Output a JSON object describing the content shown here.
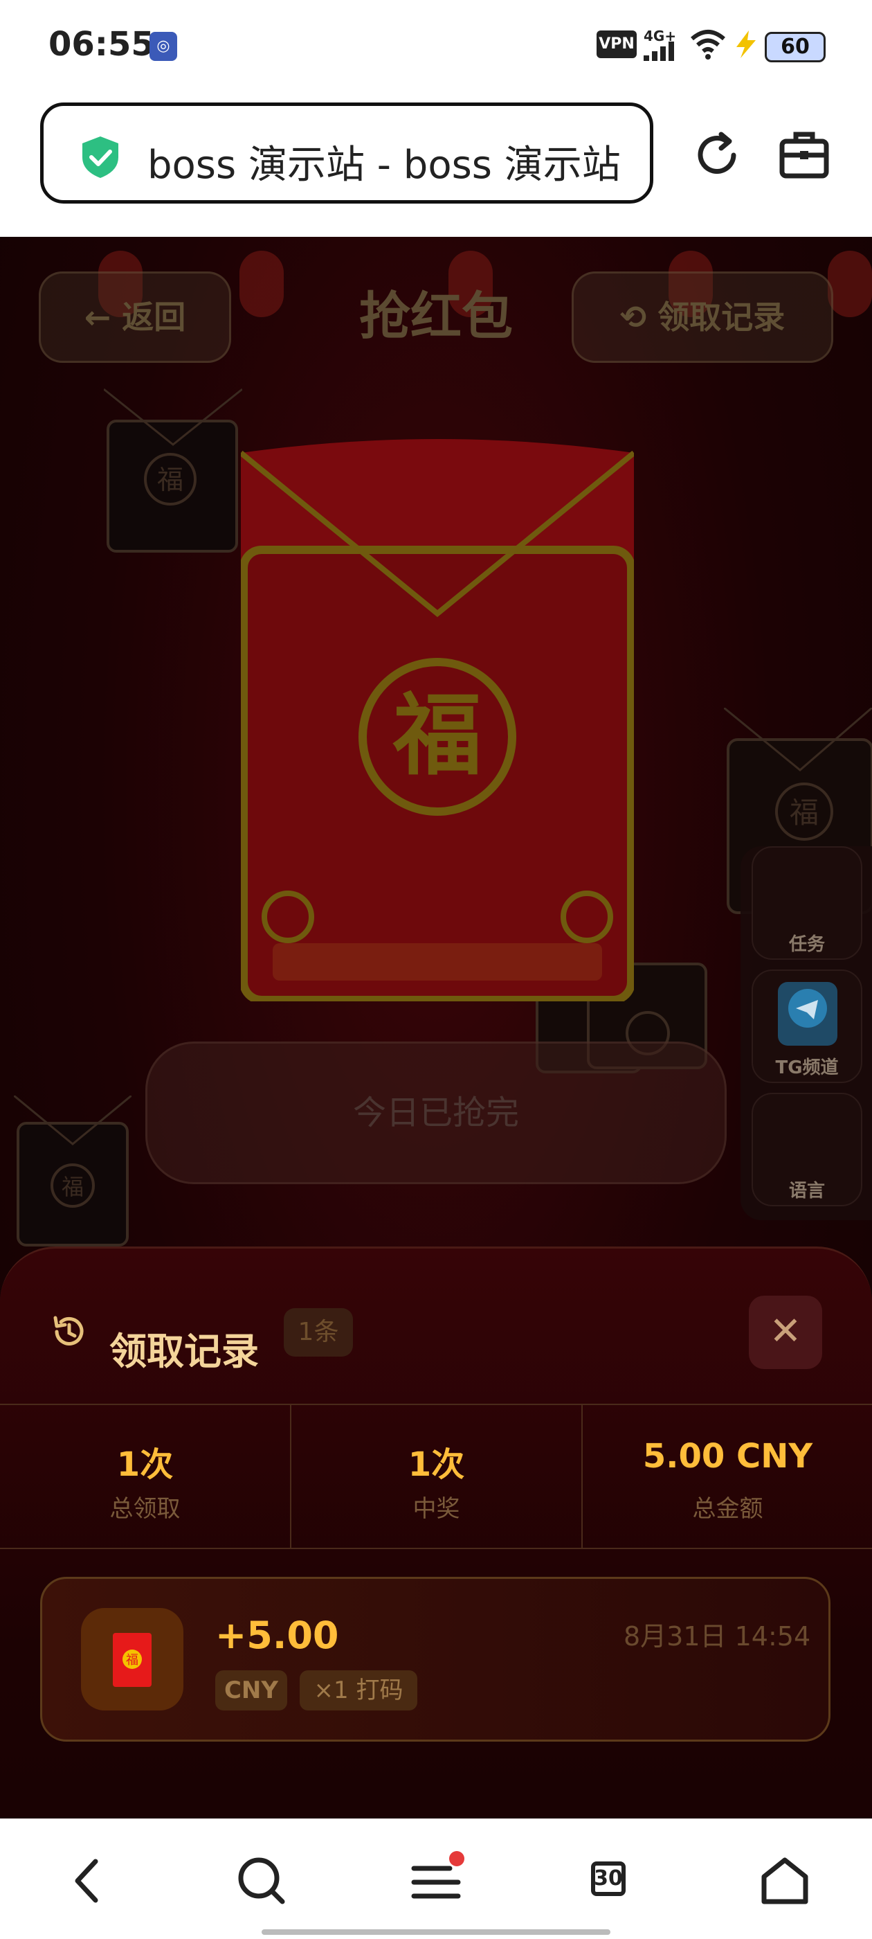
{
  "status_bar": {
    "time": "06:55",
    "notification_icon": "app-notification-icon",
    "vpn_label": "VPN",
    "network_label": "4G+",
    "battery": "60"
  },
  "browser": {
    "address_text": "boss 演示站 - boss 演示站",
    "secure_icon": "shield-check-icon",
    "reload_icon": "reload-icon",
    "toolbox_icon": "toolbox-icon"
  },
  "page": {
    "back_label": "返回",
    "title": "抢红包",
    "history_label": "领取记录",
    "envelope_char": "福",
    "grab_button_label": "今日已抢完",
    "side_menu": [
      {
        "label": "任务",
        "icon": "task-icon"
      },
      {
        "label": "TG频道",
        "icon": "telegram-icon"
      },
      {
        "label": "语言",
        "icon": "language-icon"
      }
    ]
  },
  "history_sheet": {
    "title": "领取记录",
    "count_badge": "1条",
    "stats": [
      {
        "value": "1次",
        "label": "总领取"
      },
      {
        "value": "1次",
        "label": "中奖"
      },
      {
        "value": "5.00 CNY",
        "label": "总金额"
      }
    ],
    "records": [
      {
        "amount": "+5.00",
        "currency": "CNY",
        "multiplier": "×1 打码",
        "time": "8月31日 14:54",
        "icon_char": "福"
      }
    ]
  },
  "nav_bar": {
    "tabs_count": "30",
    "items": [
      "back-icon",
      "search-icon",
      "menu-icon",
      "tabs-icon",
      "home-icon"
    ]
  },
  "colors": {
    "accent_gold": "#ffbd3a",
    "envelope_red": "#c0141a",
    "sheet_bg": "#1c0203"
  }
}
